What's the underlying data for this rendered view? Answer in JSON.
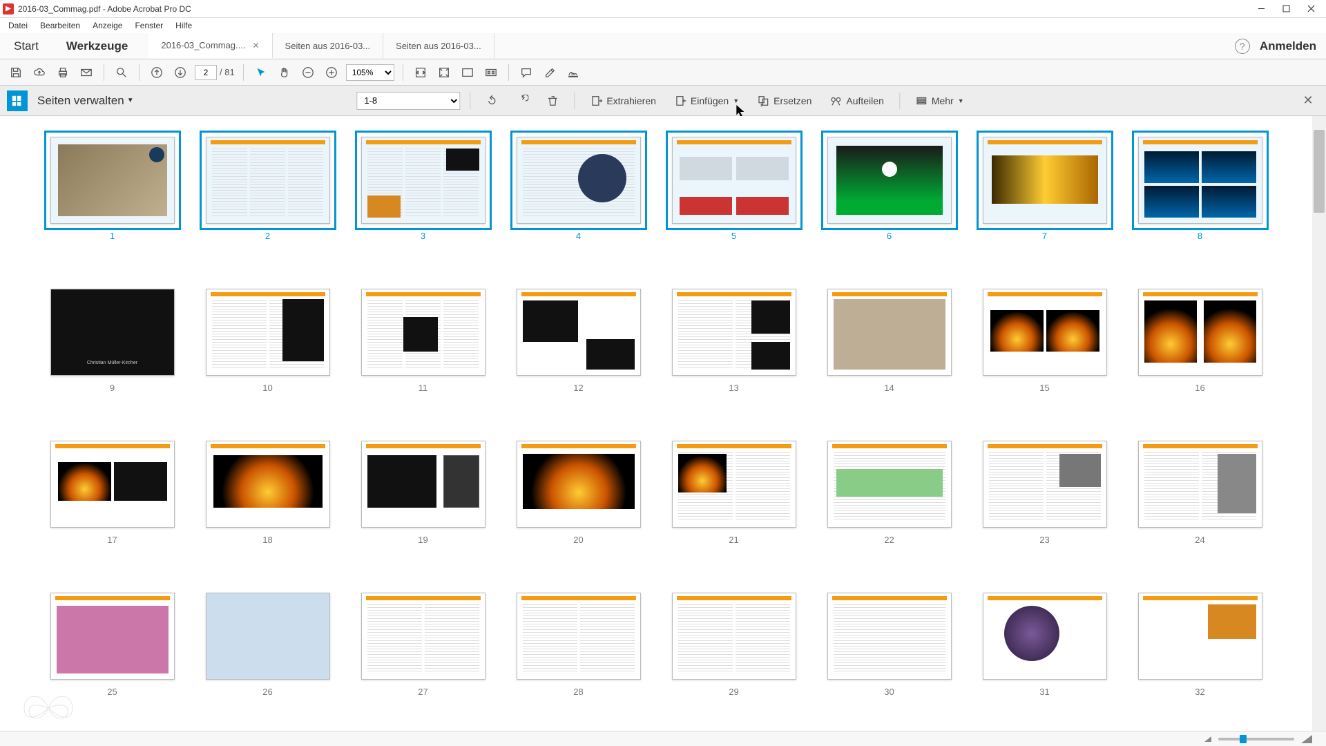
{
  "window": {
    "title": "2016-03_Commag.pdf - Adobe Acrobat Pro DC"
  },
  "menubar": {
    "items": [
      "Datei",
      "Bearbeiten",
      "Anzeige",
      "Fenster",
      "Hilfe"
    ]
  },
  "primary_tabs": {
    "start": "Start",
    "tools": "Werkzeuge"
  },
  "doc_tabs": [
    {
      "label": "2016-03_Commag....",
      "active": true,
      "closable": true
    },
    {
      "label": "Seiten aus 2016-03...",
      "active": false,
      "closable": false
    },
    {
      "label": "Seiten aus 2016-03...",
      "active": false,
      "closable": false
    }
  ],
  "right_controls": {
    "signin": "Anmelden"
  },
  "main_toolbar": {
    "page_current": "2",
    "page_total": "/ 81",
    "zoom": "105%"
  },
  "organize_bar": {
    "title": "Seiten verwalten",
    "range": "1-8",
    "actions": {
      "extract": "Extrahieren",
      "insert": "Einfügen",
      "replace": "Ersetzen",
      "split": "Aufteilen",
      "more": "Mehr"
    }
  },
  "thumbs": {
    "count": 32,
    "selected_start": 1,
    "selected_end": 8
  }
}
